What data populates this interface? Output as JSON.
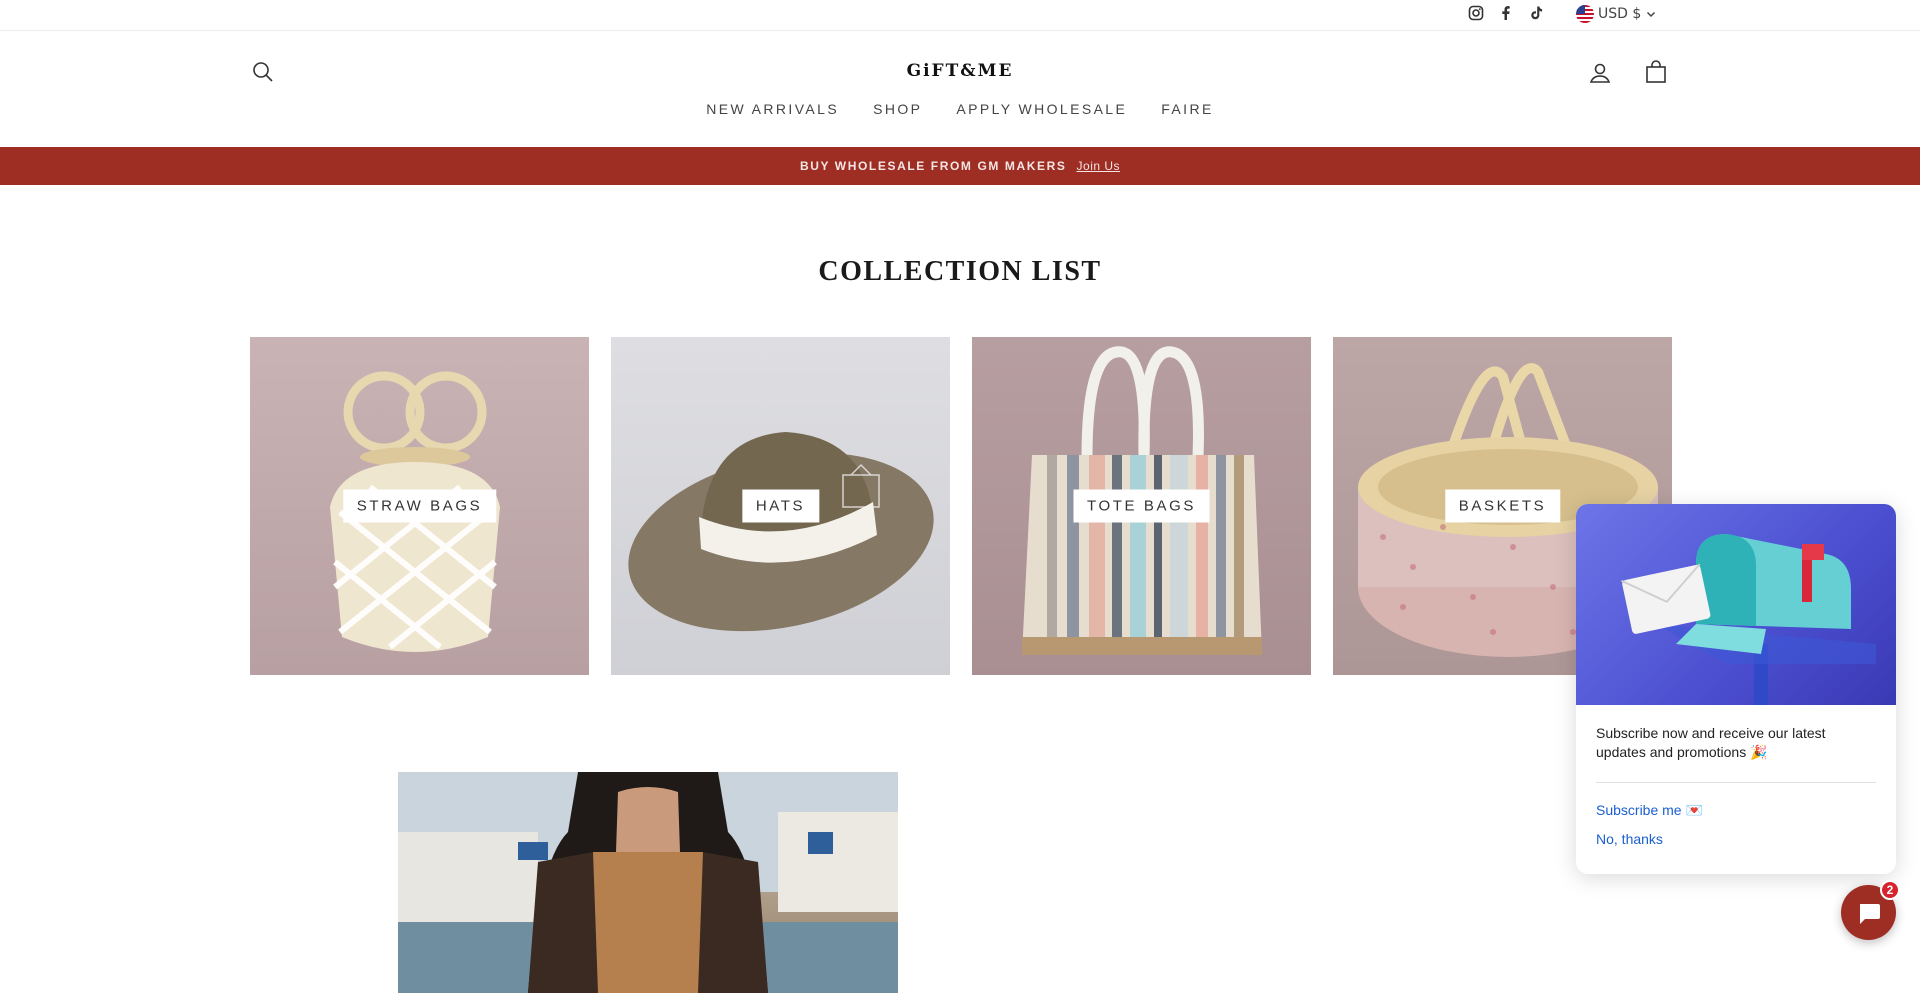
{
  "topbar": {
    "social_icons": [
      "instagram-icon",
      "facebook-icon",
      "tiktok-icon"
    ],
    "currency": "USD $"
  },
  "header": {
    "logo": "GiFT&ME",
    "nav": [
      "NEW ARRIVALS",
      "SHOP",
      "APPLY WHOLESALE",
      "FAIRE"
    ]
  },
  "promo": {
    "text": "BUY WHOLESALE FROM GM MAKERS",
    "link": "Join Us",
    "color": "#9e2d24"
  },
  "collections": {
    "title": "COLLECTION LIST",
    "items": [
      {
        "label": "STRAW BAGS"
      },
      {
        "label": "HATS"
      },
      {
        "label": "TOTE BAGS"
      },
      {
        "label": "BASKETS"
      }
    ]
  },
  "popup": {
    "message": "Subscribe now and receive our latest updates and promotions 🎉",
    "subscribe": "Subscribe me 💌",
    "decline": "No, thanks",
    "link_color": "#1a5fd0"
  },
  "chat": {
    "badge": "2"
  }
}
